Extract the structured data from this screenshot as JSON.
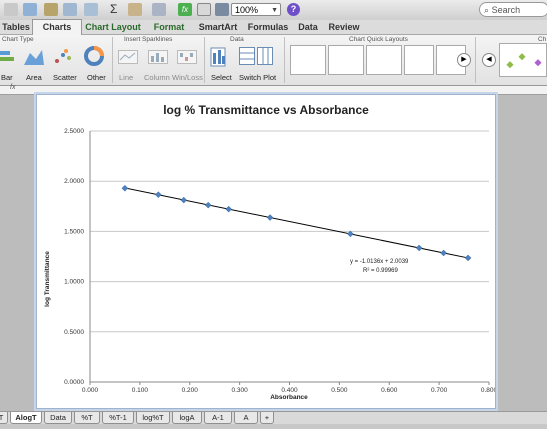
{
  "toolbar": {
    "zoom_value": "100%",
    "help_glyph": "?",
    "search_placeholder": "Search"
  },
  "ribbon_tabs": [
    "Tables",
    "Charts",
    "Chart Layout",
    "Format",
    "SmartArt",
    "Formulas",
    "Data",
    "Review"
  ],
  "ribbon": {
    "group_chart_type": "Chart Type",
    "group_sparklines": "Insert Sparklines",
    "group_data": "Data",
    "group_quick_layouts": "Chart Quick Layouts",
    "group_styles": "Ch",
    "chart_types": [
      "Bar",
      "Area",
      "Scatter",
      "Other"
    ],
    "sparklines": [
      "Line",
      "Column",
      "Win/Loss"
    ],
    "data_buttons": [
      "Select",
      "Switch Plot"
    ]
  },
  "formula_bar": {
    "fx": "fx"
  },
  "chart_data": {
    "type": "scatter",
    "title": "log % Transmittance vs Absorbance",
    "xlabel": "Absorbance",
    "ylabel": "log Transmittance",
    "xlim": [
      0,
      0.8
    ],
    "ylim": [
      0,
      2.5
    ],
    "x_ticks": [
      "0.000",
      "0.100",
      "0.200",
      "0.300",
      "0.400",
      "0.500",
      "0.600",
      "0.700",
      "0.800"
    ],
    "y_ticks": [
      "0.0000",
      "0.5000",
      "1.0000",
      "1.5000",
      "2.0000",
      "2.5000"
    ],
    "grid": "horizontal",
    "points": [
      {
        "x": 0.07,
        "y": 1.93
      },
      {
        "x": 0.137,
        "y": 1.866
      },
      {
        "x": 0.188,
        "y": 1.812
      },
      {
        "x": 0.237,
        "y": 1.762
      },
      {
        "x": 0.278,
        "y": 1.722
      },
      {
        "x": 0.361,
        "y": 1.638
      },
      {
        "x": 0.522,
        "y": 1.475
      },
      {
        "x": 0.66,
        "y": 1.335
      },
      {
        "x": 0.709,
        "y": 1.285
      },
      {
        "x": 0.758,
        "y": 1.236
      }
    ],
    "trendline": {
      "slope": -1.0136,
      "intercept": 2.0039
    },
    "equation": "y = -1.0136x + 2.0039",
    "r_squared": "R² = 0.99969",
    "marker_color": "#4f81bd",
    "line_color": "#000000"
  },
  "sheet_tabs": [
    "T",
    "AlogT",
    "Data",
    "%T",
    "%T-1",
    "log%T",
    "logA",
    "A-1",
    "A",
    "+"
  ],
  "active_sheet": "AlogT"
}
